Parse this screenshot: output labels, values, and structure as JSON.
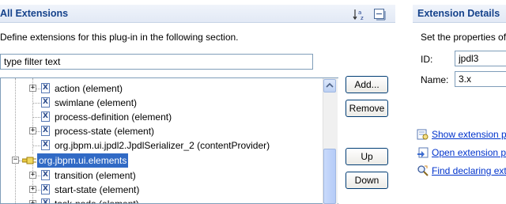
{
  "left_section": {
    "title": "All Extensions",
    "description": "Define extensions for this plug-in in the following section.",
    "filter": {
      "value": "type filter text"
    },
    "tree": [
      {
        "label": "action (element)",
        "expandable": true
      },
      {
        "label": "swimlane (element)",
        "expandable": false
      },
      {
        "label": "process-definition (element)",
        "expandable": false
      },
      {
        "label": "process-state (element)",
        "expandable": true
      },
      {
        "label": "org.jbpm.ui.jpdl2.JpdlSerializer_2 (contentProvider)",
        "expandable": false
      },
      {
        "label": "org.jbpm.ui.elements",
        "expandable": true,
        "expanded": true,
        "selected": true
      },
      {
        "label": "transition (element)",
        "expandable": true
      },
      {
        "label": "start-state (element)",
        "expandable": true
      },
      {
        "label": "task-node (element)",
        "expandable": true
      }
    ],
    "buttons": {
      "add": "Add...",
      "remove": "Remove",
      "up": "Up",
      "down": "Down"
    }
  },
  "right_section": {
    "title": "Extension Details",
    "description": "Set the properties of",
    "id_label": "ID:",
    "id_value": "jpdl3",
    "name_label": "Name:",
    "name_value": "3.x",
    "links": [
      {
        "label": "Show extension po",
        "icon": "show-extension-icon"
      },
      {
        "label": "Open extension po",
        "icon": "open-extension-icon"
      },
      {
        "label": "Find declaring exte",
        "icon": "find-declaring-icon"
      }
    ]
  },
  "colors": {
    "header_text": "#15428b",
    "selection": "#316ac5",
    "link": "#0033cc"
  }
}
